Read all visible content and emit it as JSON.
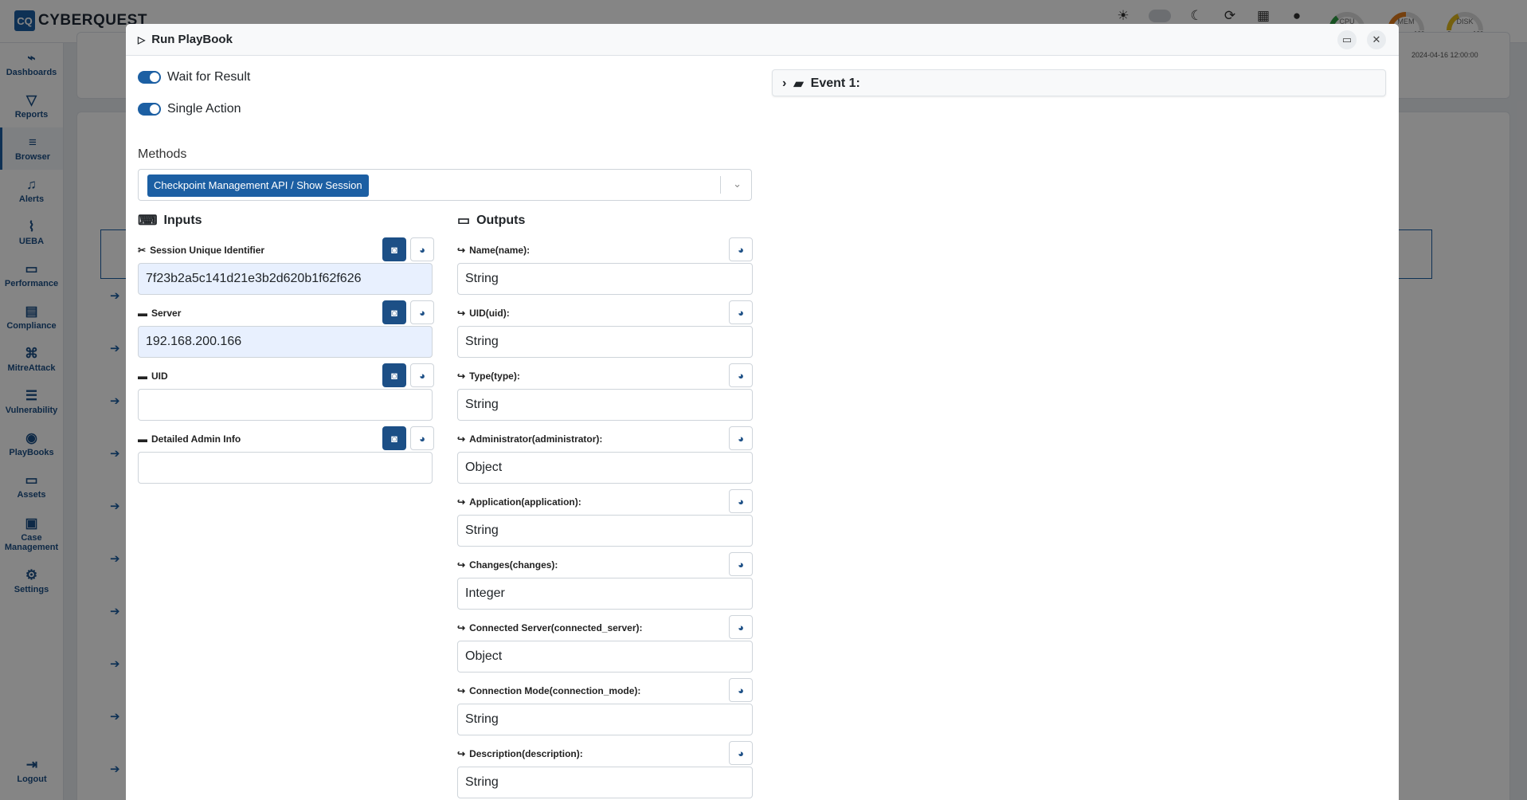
{
  "app": {
    "logo_text": "CYBERQUEST",
    "logo_mark": "CQ"
  },
  "gauges": [
    {
      "label": "CPU",
      "min": "",
      "max": "100",
      "color": "#2e9e44"
    },
    {
      "label": "MEM",
      "min": "",
      "max": "100",
      "color": "#e07b1c"
    },
    {
      "label": "DISK",
      "min": "0",
      "max": "100",
      "color": "#e0b81c"
    }
  ],
  "sidebar": {
    "items": [
      {
        "label": "Dashboards",
        "icon": "chart-icon"
      },
      {
        "label": "Reports",
        "icon": "filter-icon"
      },
      {
        "label": "Browser",
        "icon": "list-icon"
      },
      {
        "label": "Alerts",
        "icon": "bell-icon"
      },
      {
        "label": "UEBA",
        "icon": "chart-line-icon"
      },
      {
        "label": "Performance",
        "icon": "keyboard-icon"
      },
      {
        "label": "Compliance",
        "icon": "document-icon"
      },
      {
        "label": "MitreAttack",
        "icon": "command-icon"
      },
      {
        "label": "Vulnerability",
        "icon": "stack-icon"
      },
      {
        "label": "PlayBooks",
        "icon": "playbook-icon"
      },
      {
        "label": "Assets",
        "icon": "laptop-icon"
      },
      {
        "label": "Case Management",
        "icon": "briefcase-icon"
      },
      {
        "label": "Settings",
        "icon": "gear-icon"
      }
    ],
    "logout": "Logout"
  },
  "background": {
    "date_right": "2024-04-16 12:00:00"
  },
  "modal": {
    "title": "Run PlayBook",
    "wait_for_result": "Wait for Result",
    "single_action": "Single Action",
    "methods_label": "Methods",
    "method_selected": "Checkpoint Management API / Show Session",
    "inputs_title": "Inputs",
    "outputs_title": "Outputs",
    "inputs": [
      {
        "label": "Session Unique Identifier",
        "value": "7f23b2a5c141d21e3b2d620b1f62f626"
      },
      {
        "label": "Server",
        "value": "192.168.200.166"
      },
      {
        "label": "UID",
        "value": ""
      },
      {
        "label": "Detailed Admin Info",
        "value": ""
      }
    ],
    "outputs": [
      {
        "label": "Name(name):",
        "value": "String"
      },
      {
        "label": "UID(uid):",
        "value": "String"
      },
      {
        "label": "Type(type):",
        "value": "String"
      },
      {
        "label": "Administrator(administrator):",
        "value": "Object"
      },
      {
        "label": "Application(application):",
        "value": "String"
      },
      {
        "label": "Changes(changes):",
        "value": "Integer"
      },
      {
        "label": "Connected Server(connected_server):",
        "value": "Object"
      },
      {
        "label": "Connection Mode(connection_mode):",
        "value": "String"
      },
      {
        "label": "Description(description):",
        "value": "String"
      }
    ],
    "event_title": "Event 1:"
  }
}
